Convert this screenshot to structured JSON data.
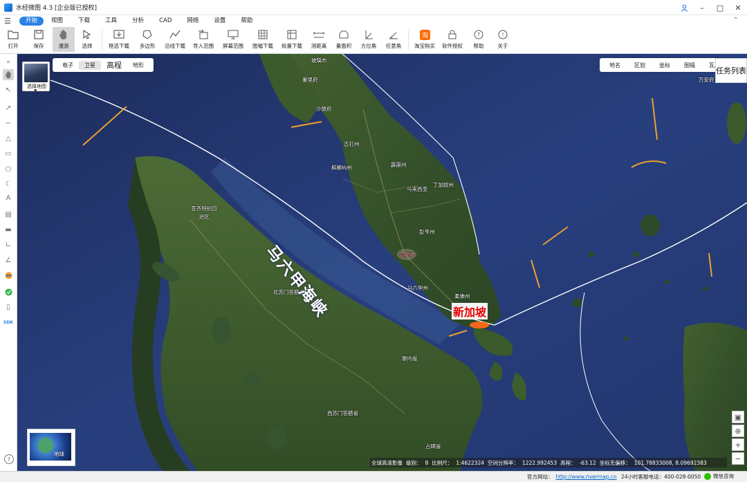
{
  "app": {
    "title": "水经微图 4.3 [企业版已授权]",
    "accent": "#2a82e4"
  },
  "menu": [
    "开始",
    "视图",
    "下载",
    "工具",
    "分析",
    "CAD",
    "网络",
    "设置",
    "帮助"
  ],
  "toolbar": {
    "open": "打开",
    "save": "保存",
    "pan": "漫游",
    "select": "选择",
    "rect_download": "框选下载",
    "polygon": "多边形",
    "line_download": "沿线下载",
    "import_range": "导入范围",
    "screen_range": "屏幕范围",
    "sheet_download": "图幅下载",
    "batch_download": "批量下载",
    "measure_distance": "测距离",
    "measure_area": "量面积",
    "azimuth": "方位角",
    "any_angle": "任意角",
    "taobao": "淘宝购买",
    "license": "软件授权",
    "help": "帮助",
    "about": "关于"
  },
  "map": {
    "layer_switch_label": "选择地图",
    "map_types": [
      "电子",
      "卫星",
      "高程",
      "地形"
    ],
    "selected_map_type": "卫星",
    "tools": [
      "地名",
      "区划",
      "坐标",
      "图幅",
      "瓦片"
    ],
    "task_list": "任务列表",
    "globe_label": "地球",
    "annotations": {
      "strait": "马六甲海峡",
      "singapore": "新加坡"
    },
    "place_labels": {
      "perlis": "玻璃市",
      "kedah": "吉打州",
      "penang": "槟榔屿州",
      "perak": "霹雳州",
      "terengganu": "丁加奴州",
      "pahang": "彭亨州",
      "malaysia": "马来西亚",
      "kuala_lumpur": "吉隆坡",
      "melaka": "马六甲州",
      "johor": "柔佛州",
      "aceh": "亚齐特别自治区",
      "north_sumatra": "北苏门答腊省",
      "riau": "廖内省",
      "west_sumatra": "西苏门答腊省",
      "jambi": "占碑省",
      "songkhla": "董里府",
      "satun": "沙敦府",
      "narathiwat": "万安府"
    }
  },
  "coord_bar": {
    "source": "全球高清影像",
    "level_label": "级别：",
    "level": "8",
    "scale_label": "比例尺：",
    "scale": "1:4622324",
    "resolution_label": "空间分辨率：",
    "resolution": "1222.992453",
    "elevation_label": "高程：",
    "elevation": "-63.12",
    "coords_label": "坐标无偏移：",
    "coords": "101.78833008, 8.09692383"
  },
  "status": {
    "site_label": "官方网站：",
    "site_url": "http://www.rivermap.cn",
    "hotline_label": "24小时客服电话：",
    "hotline": "400-028-0050",
    "wechat": "微信咨询"
  }
}
